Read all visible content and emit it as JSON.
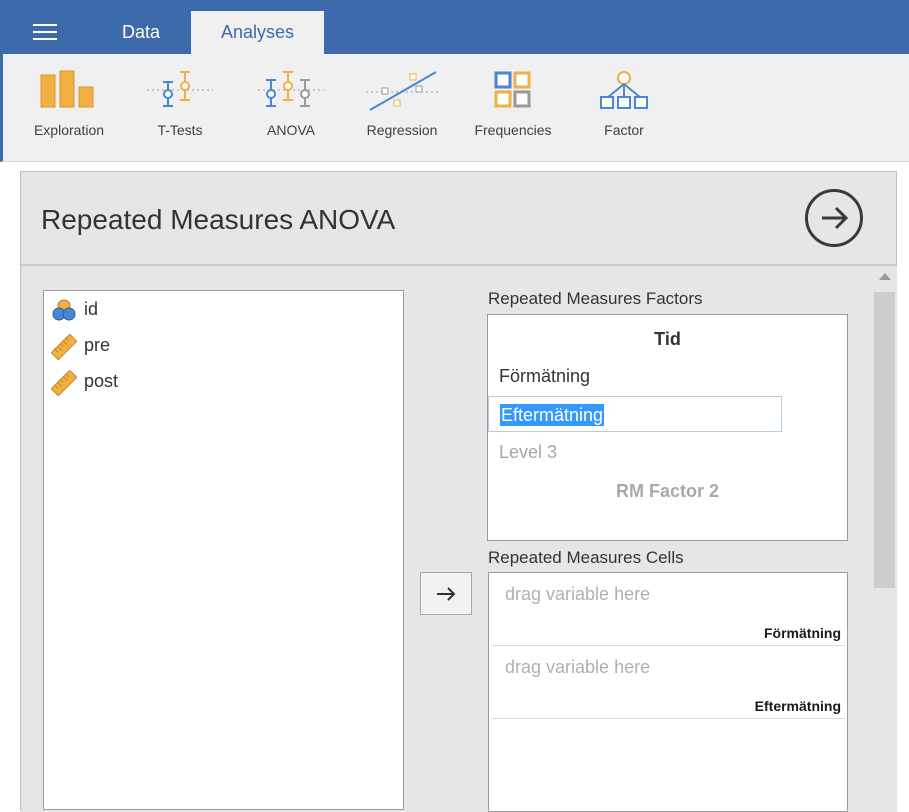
{
  "tabs": {
    "data": "Data",
    "analyses": "Analyses"
  },
  "ribbon": {
    "items": [
      {
        "label": "Exploration",
        "icon": "exploration-icon"
      },
      {
        "label": "T-Tests",
        "icon": "t-tests-icon"
      },
      {
        "label": "ANOVA",
        "icon": "anova-icon"
      },
      {
        "label": "Regression",
        "icon": "regression-icon"
      },
      {
        "label": "Frequencies",
        "icon": "frequencies-icon"
      },
      {
        "label": "Factor",
        "icon": "factor-icon"
      }
    ]
  },
  "panel": {
    "title": "Repeated Measures ANOVA"
  },
  "variables": [
    {
      "name": "id",
      "type": "nominal"
    },
    {
      "name": "pre",
      "type": "continuous"
    },
    {
      "name": "post",
      "type": "continuous"
    }
  ],
  "rm_factors": {
    "label": "Repeated Measures Factors",
    "factor_name": "Tid",
    "levels": [
      "Förmätning",
      "Eftermätning",
      "Level 3"
    ],
    "add_factor_placeholder": "RM Factor 2"
  },
  "rm_cells": {
    "label": "Repeated Measures Cells",
    "cells": [
      {
        "placeholder": "drag variable here",
        "level": "Förmätning"
      },
      {
        "placeholder": "drag variable here",
        "level": "Eftermätning"
      }
    ]
  },
  "colors": {
    "topbar": "#3c6aab",
    "accent_orange": "#f0b043",
    "accent_blue": "#4a86d4",
    "selection": "#3399ff"
  }
}
